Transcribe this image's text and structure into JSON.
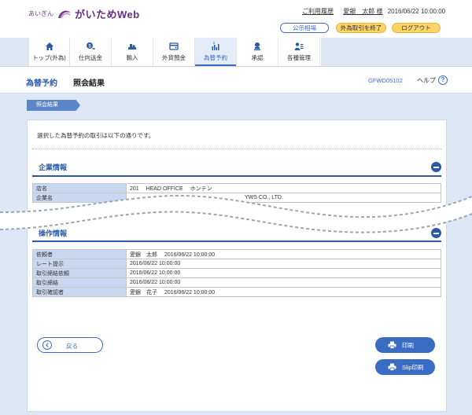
{
  "header": {
    "logo_small": "あいぎん",
    "logo_main": "がいためWeb",
    "usage_history": "ご利用履歴",
    "user_name": "愛銀　太郎 様",
    "login_time": "2016/06/22 10:00:00",
    "public_rates_label": "公示相場",
    "end_fx_label": "外為取引を終了",
    "logout_label": "ログアウト"
  },
  "nav": {
    "items": [
      {
        "label": "トップ(外為)",
        "icon": "home-icon"
      },
      {
        "label": "仕向送金",
        "icon": "remittance-icon"
      },
      {
        "label": "輸入",
        "icon": "import-icon"
      },
      {
        "label": "外貨預金",
        "icon": "deposit-icon"
      },
      {
        "label": "為替予約",
        "icon": "fx-forward-icon"
      },
      {
        "label": "承認",
        "icon": "approval-icon"
      },
      {
        "label": "各種管理",
        "icon": "admin-icon"
      }
    ],
    "active_index": 4
  },
  "page": {
    "section": "為替予約",
    "title": "照会結果",
    "screen_id": "GFWD05102",
    "help_label": "ヘルプ",
    "help_icon": "?",
    "step": "照会結果",
    "intro": "選択した為替予約の取引は以下の通りです。"
  },
  "company_info": {
    "title": "企業情報",
    "rows": [
      {
        "label": "店名",
        "value": "201　 HEAD OFFICE　 ホンテン"
      },
      {
        "label": "企業名",
        "value": "YWS CO., LTD."
      }
    ]
  },
  "operation_info": {
    "title": "操作情報",
    "rows": [
      {
        "label": "依頼者",
        "value": "愛銀　太郎　  2016/06/22 10:00:00"
      },
      {
        "label": "レート提示",
        "value": "2016/06/22 10:00:00"
      },
      {
        "label": "取引締結依頼",
        "value": "2016/06/22 10:00:00"
      },
      {
        "label": "取引締結",
        "value": "2016/06/22 10:00:00"
      },
      {
        "label": "取引確認者",
        "value": "愛銀　花子　  2016/06/22 10:00:00"
      }
    ]
  },
  "buttons": {
    "back": "戻る",
    "print": "印刷",
    "slip_print": "Slip印刷"
  },
  "colors": {
    "accent": "#3b6cc4",
    "section_blue": "#2a5aa8",
    "header_cell": "#c8d8f1",
    "yellow_button": "#fbd366",
    "background": "#dde7f5"
  }
}
